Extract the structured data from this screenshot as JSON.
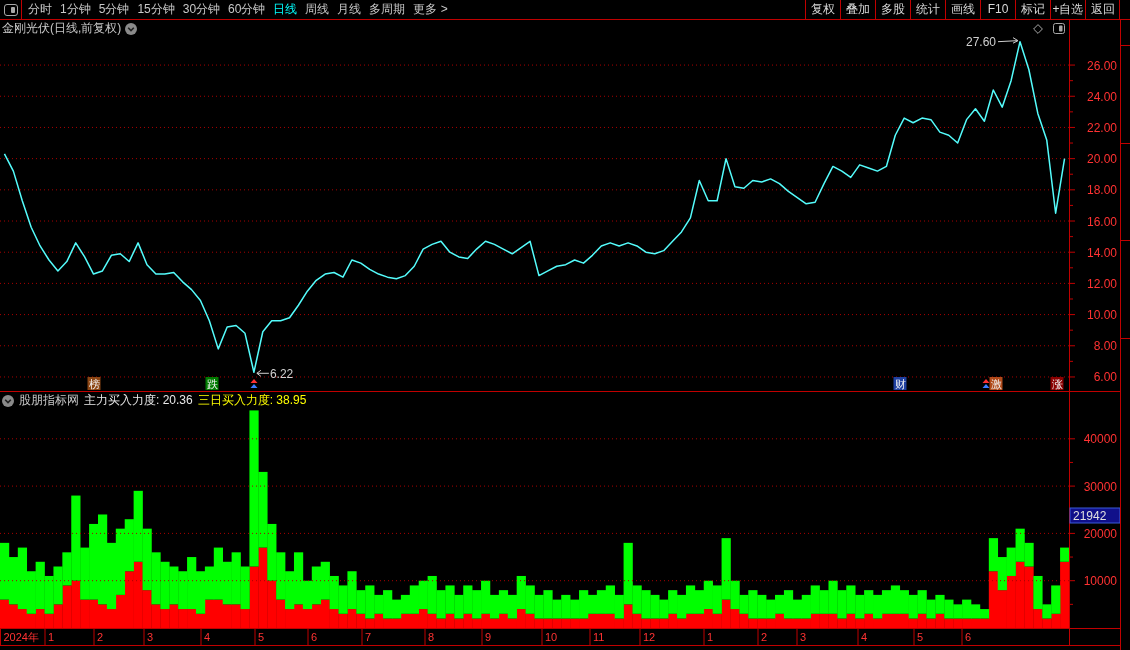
{
  "toolbar": {
    "periods": [
      {
        "label": "分时",
        "selected": false
      },
      {
        "label": "1分钟",
        "selected": false
      },
      {
        "label": "5分钟",
        "selected": false
      },
      {
        "label": "15分钟",
        "selected": false
      },
      {
        "label": "30分钟",
        "selected": false
      },
      {
        "label": "60分钟",
        "selected": false
      },
      {
        "label": "日线",
        "selected": true
      },
      {
        "label": "周线",
        "selected": false
      },
      {
        "label": "月线",
        "selected": false
      },
      {
        "label": "多周期",
        "selected": false
      },
      {
        "label": "更多 >",
        "selected": false
      }
    ],
    "actions": [
      "复权",
      "叠加",
      "多股",
      "统计",
      "画线",
      "F10",
      "标记",
      "+自选",
      "返回"
    ]
  },
  "price_panel": {
    "title": "金刚光伏(日线,前复权)",
    "chart_data": {
      "type": "line",
      "grid": true,
      "ylim": [
        5.1,
        27.8
      ],
      "yticks": [
        {
          "value": 6,
          "label": "6.00"
        },
        {
          "value": 8,
          "label": "8.00"
        },
        {
          "value": 10,
          "label": "10.00"
        },
        {
          "value": 12,
          "label": "12.00"
        },
        {
          "value": 14,
          "label": "14.00"
        },
        {
          "value": 16,
          "label": "16.00"
        },
        {
          "value": 18,
          "label": "18.00"
        },
        {
          "value": 20,
          "label": "20.00"
        },
        {
          "value": 22,
          "label": "22.00"
        },
        {
          "value": 24,
          "label": "24.00"
        },
        {
          "value": 26,
          "label": "26.00"
        }
      ],
      "series": [
        {
          "values": [
            20.3,
            19.2,
            17.3,
            15.6,
            14.4,
            13.5,
            12.8,
            13.4,
            14.6,
            13.7,
            12.6,
            12.8,
            13.8,
            13.9,
            13.4,
            14.6,
            13.2,
            12.6,
            12.6,
            12.7,
            12.1,
            11.6,
            10.9,
            9.6,
            7.8,
            9.2,
            9.3,
            8.8,
            6.3,
            8.9,
            9.6,
            9.6,
            9.8,
            10.6,
            11.5,
            12.2,
            12.6,
            12.7,
            12.4,
            13.5,
            13.3,
            12.9,
            12.6,
            12.4,
            12.3,
            12.5,
            13.1,
            14.2,
            14.5,
            14.7,
            14.0,
            13.7,
            13.6,
            14.2,
            14.7,
            14.5,
            14.2,
            13.9,
            14.3,
            14.7,
            12.5,
            12.8,
            13.1,
            13.2,
            13.5,
            13.3,
            13.8,
            14.4,
            14.6,
            14.4,
            14.6,
            14.4,
            14.0,
            13.9,
            14.1,
            14.7,
            15.3,
            16.2,
            18.6,
            17.3,
            17.3,
            20.0,
            18.2,
            18.1,
            18.6,
            18.5,
            18.7,
            18.4,
            17.9,
            17.5,
            17.1,
            17.2,
            18.4,
            19.5,
            19.2,
            18.8,
            19.6,
            19.4,
            19.2,
            19.5,
            21.5,
            22.6,
            22.3,
            22.6,
            22.5,
            21.7,
            21.5,
            21.0,
            22.5,
            23.2,
            22.4,
            24.4,
            23.3,
            25.0,
            27.5,
            25.7,
            22.9,
            21.2,
            16.5,
            20.0
          ]
        }
      ],
      "annotations": [
        "27.60",
        "6.22"
      ]
    },
    "markers": [
      {
        "kind": "tag",
        "label": "榜",
        "color": "#8b4513"
      },
      {
        "kind": "tag",
        "label": "跌",
        "color": "#007a00"
      },
      {
        "kind": "icon"
      },
      {
        "kind": "tag",
        "label": "财",
        "color": "#2040a0"
      },
      {
        "kind": "icon"
      },
      {
        "kind": "tag",
        "label": "激",
        "color": "#b04a1a"
      },
      {
        "kind": "tag",
        "label": "涨",
        "color": "#8b0000"
      }
    ]
  },
  "indicator_panel": {
    "name": "股朋指标网",
    "readouts": [
      {
        "text": "主力买入力度: 20.36",
        "color": "#e8e8e8"
      },
      {
        "text": "三日买入力度: 38.95",
        "color": "#ffff00"
      }
    ],
    "current_value": "21942",
    "chart_data": {
      "type": "bar",
      "stacked": true,
      "grid": true,
      "ylim": [
        0,
        46300
      ],
      "yticks": [
        10000,
        20000,
        30000,
        40000
      ],
      "series": [
        {
          "color": "#ff0000",
          "values": [
            6000,
            5000,
            4000,
            3000,
            4000,
            3000,
            5000,
            9000,
            10000,
            6000,
            6000,
            5000,
            4000,
            7000,
            12000,
            14000,
            8000,
            5000,
            4000,
            5000,
            4000,
            4000,
            3000,
            6000,
            6000,
            5000,
            5000,
            4000,
            13000,
            17000,
            10000,
            6000,
            4000,
            5000,
            4000,
            5000,
            6000,
            4000,
            3000,
            4000,
            3000,
            2000,
            3000,
            2000,
            2000,
            3000,
            3000,
            4000,
            3000,
            2000,
            3000,
            2000,
            3000,
            2000,
            3000,
            2000,
            3000,
            2000,
            4000,
            3000,
            2000,
            2000,
            2000,
            2000,
            2000,
            2000,
            3000,
            3000,
            3000,
            2000,
            5000,
            3000,
            2000,
            2000,
            2000,
            3000,
            2000,
            3000,
            3000,
            4000,
            3000,
            6000,
            4000,
            3000,
            2000,
            2000,
            2000,
            3000,
            2000,
            2000,
            2000,
            3000,
            3000,
            3000,
            2000,
            3000,
            2000,
            3000,
            2000,
            3000,
            3000,
            3000,
            2000,
            3000,
            2000,
            3000,
            2000,
            2000,
            2000,
            2000,
            2000,
            12000,
            8000,
            11000,
            14000,
            13000,
            4000,
            2000,
            3000,
            14000
          ]
        },
        {
          "color": "#00ff00",
          "values": [
            12000,
            10000,
            13000,
            9000,
            10000,
            8000,
            8000,
            7000,
            18000,
            11000,
            16000,
            19000,
            14000,
            14000,
            11000,
            15000,
            13000,
            11000,
            10000,
            8000,
            8000,
            11000,
            9000,
            7000,
            11000,
            9000,
            11000,
            9000,
            33000,
            16000,
            12000,
            10000,
            8000,
            11000,
            6000,
            8000,
            8000,
            7000,
            6000,
            8000,
            5000,
            7000,
            4000,
            6000,
            4000,
            4000,
            6000,
            6000,
            8000,
            6000,
            6000,
            5000,
            6000,
            6000,
            7000,
            5000,
            5000,
            5000,
            7000,
            6000,
            5000,
            6000,
            4000,
            5000,
            4000,
            6000,
            4000,
            5000,
            6000,
            5000,
            13000,
            6000,
            6000,
            5000,
            4000,
            5000,
            5000,
            6000,
            5000,
            6000,
            6000,
            13000,
            6000,
            4000,
            6000,
            5000,
            4000,
            4000,
            6000,
            4000,
            5000,
            6000,
            5000,
            7000,
            6000,
            6000,
            5000,
            5000,
            5000,
            5000,
            6000,
            5000,
            5000,
            5000,
            4000,
            4000,
            4000,
            3000,
            4000,
            3000,
            2000,
            7000,
            7000,
            6000,
            7000,
            5000,
            7000,
            3000,
            6000,
            3000
          ]
        }
      ]
    },
    "date_axis": [
      "2024年",
      "1",
      "2",
      "3",
      "4",
      "5",
      "6",
      "7",
      "8",
      "9",
      "10",
      "11",
      "12",
      "1",
      "2",
      "3",
      "4",
      "5",
      "6"
    ]
  }
}
